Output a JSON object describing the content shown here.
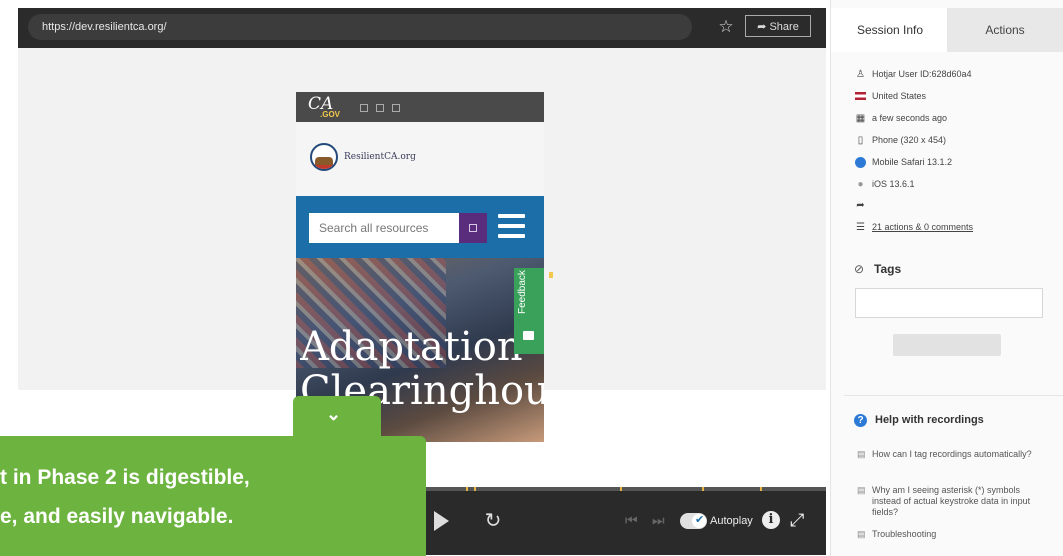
{
  "browser": {
    "url": "https://dev.resilientca.org/",
    "share_label": "Share"
  },
  "mobile_page": {
    "ca_logo": "CA",
    "ca_logo_sub": ".GOV",
    "site_name": "ResilientCA.org",
    "search_placeholder": "Search all resources",
    "hero_title_line1": "Adaptation",
    "hero_title_line2": "Clearinghou",
    "feedback_label": "Feedback"
  },
  "overlay": {
    "line1": "t in Phase 2 is digestible,",
    "line2": "e, and easily navigable."
  },
  "player": {
    "autoplay_label": "Autoplay",
    "autoplay_on": true
  },
  "panel": {
    "tabs": [
      {
        "label": "Session Info",
        "active": true
      },
      {
        "label": "Actions",
        "active": false
      }
    ],
    "session": {
      "user_id": "Hotjar User ID:628d60a4",
      "country": "United States",
      "time": "a few seconds ago",
      "device": "Phone (320 x 454)",
      "browser": "Mobile Safari 13.1.2",
      "os": "iOS 13.6.1",
      "referrer": "",
      "actions_comments": "21 actions & 0 comments"
    },
    "tags": {
      "title": "Tags",
      "input_placeholder": "",
      "button_label": ""
    },
    "help": {
      "title": "Help with recordings",
      "links": [
        "How can I tag recordings automatically?",
        "Why am I seeing asterisk (*) symbols instead of actual keystroke data in input fields?",
        "Troubleshooting"
      ]
    }
  },
  "colors": {
    "overlay_green": "#6cb33f",
    "ca_blue": "#1c6ea8",
    "search_purple": "#5a2c7c",
    "help_blue": "#2d7ad6"
  }
}
